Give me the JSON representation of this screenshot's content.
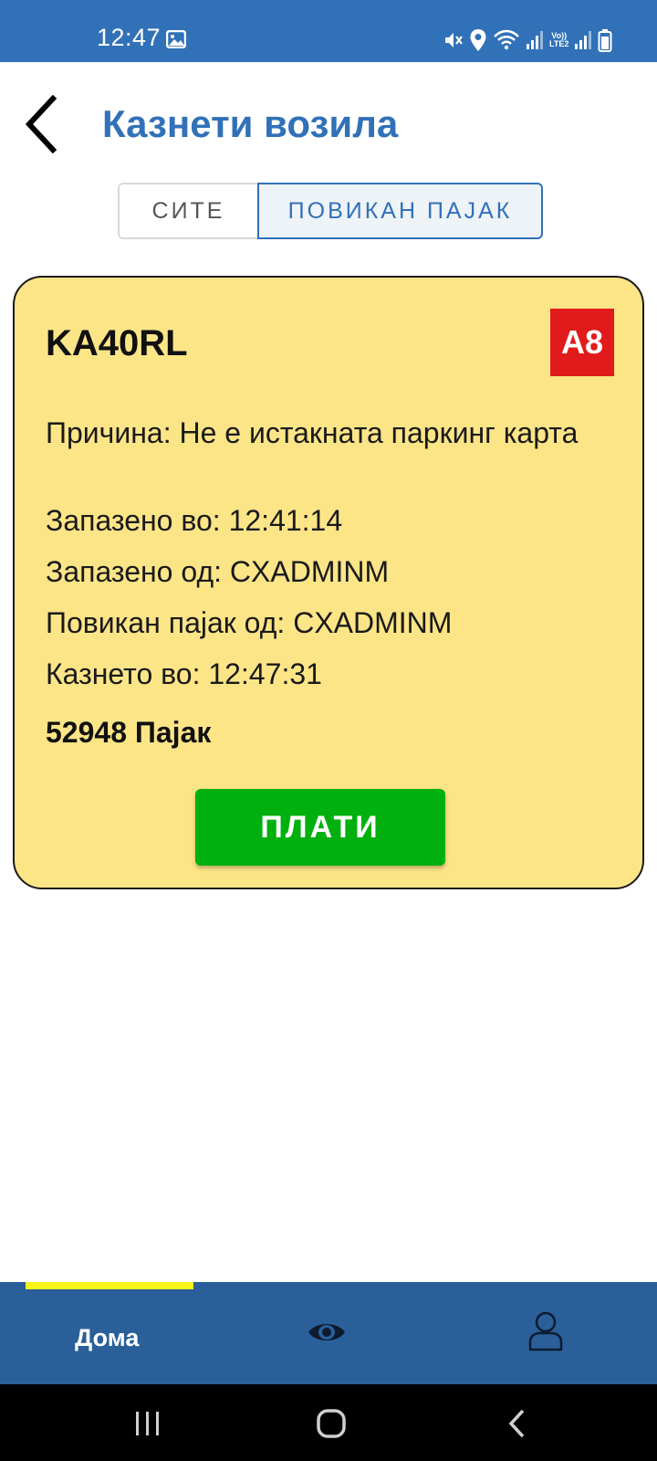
{
  "status_bar": {
    "time": "12:47",
    "volte_label_top": "Vo))",
    "volte_label_bottom": "LTE2"
  },
  "header": {
    "title": "Казнети возила"
  },
  "tabs": [
    {
      "label": "СИТЕ",
      "selected": false
    },
    {
      "label": "ПОВИКАН ПАЈАК",
      "selected": true
    }
  ],
  "card": {
    "plate": "KA40RL",
    "zone": "A8",
    "reason": "Причина: Не е истакната паркинг карта",
    "saved_at": "Запазено во: 12:41:14",
    "saved_by": "Запазено од: CXADMINM",
    "tow_called_by": "Повикан пајак од: CXADMINM",
    "fined_at": "Казнето во: 12:47:31",
    "tow_id": "52948 Пајак",
    "pay_label": "ПЛАТИ"
  },
  "bottom_nav": {
    "home_label": "Дома",
    "eye_icon": "eye-icon",
    "profile_icon": "profile-icon"
  },
  "colors": {
    "brand_blue": "#3171b8",
    "nav_blue": "#2a5f99",
    "card_yellow": "#fce587",
    "zone_red": "#e11b1b",
    "pay_green": "#00b00e",
    "active_indicator": "#f7f417"
  }
}
